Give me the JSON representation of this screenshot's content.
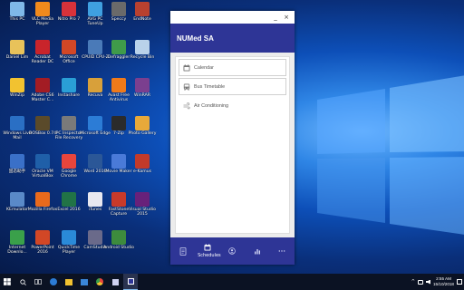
{
  "desktop": {
    "icons": [
      {
        "label": "This PC",
        "color": "#7fb8e8"
      },
      {
        "label": "VLC Media Player",
        "color": "#f08a1c"
      },
      {
        "label": "Nitro Pro 7",
        "color": "#d8323a"
      },
      {
        "label": "AVG PC TuneUp",
        "color": "#3fa0e0"
      },
      {
        "label": "Speccy",
        "color": "#6a6a6a"
      },
      {
        "label": "EndNote",
        "color": "#b8412f"
      },
      {
        "label": "Daniel Lim",
        "color": "#e8c25a"
      },
      {
        "label": "Acrobat Reader DC",
        "color": "#c9242b"
      },
      {
        "label": "Microsoft Office",
        "color": "#d24726"
      },
      {
        "label": "CPUID CPU-Z",
        "color": "#4a7ab8"
      },
      {
        "label": "Defraggler",
        "color": "#3f9b4a"
      },
      {
        "label": "Recycle Bin",
        "color": "#b9d2ea"
      },
      {
        "label": "WinZip",
        "color": "#f2c230"
      },
      {
        "label": "Adobe CS6 Master C...",
        "color": "#a31c24"
      },
      {
        "label": "Instashare",
        "color": "#2a9fd6"
      },
      {
        "label": "Recuva",
        "color": "#d8a03a"
      },
      {
        "label": "Avast Free Antivirus",
        "color": "#f07a1a"
      },
      {
        "label": "WinRAR",
        "color": "#7b3f8f"
      },
      {
        "label": "Windows Live Mail",
        "color": "#2a6fc4"
      },
      {
        "label": "DOSBox 0.74",
        "color": "#5a4a2a"
      },
      {
        "label": "PC Inspector File Recovery",
        "color": "#7a7a7a"
      },
      {
        "label": "Microsoft Edge",
        "color": "#2c7cd6"
      },
      {
        "label": "7-Zip",
        "color": "#2b2b2b"
      },
      {
        "label": "Photo Gallery",
        "color": "#e8a93a"
      },
      {
        "label": "固态助手",
        "color": "#3a70c8"
      },
      {
        "label": "Oracle VM VirtualBox",
        "color": "#1f5fa8"
      },
      {
        "label": "Google Chrome",
        "color": "#e8453c"
      },
      {
        "label": "Word 2016",
        "color": "#2b5797"
      },
      {
        "label": "Movie Maker",
        "color": "#4a7ad8"
      },
      {
        "label": "e-Kamus",
        "color": "#c23a2a"
      },
      {
        "label": "KEmulator",
        "color": "#5a8ac8"
      },
      {
        "label": "Mozilla Firefox",
        "color": "#e86a1c"
      },
      {
        "label": "Excel 2016",
        "color": "#217346"
      },
      {
        "label": "iTunes",
        "color": "#e8e8f0"
      },
      {
        "label": "FastStone Capture",
        "color": "#c83a2a"
      },
      {
        "label": "Visual Studio 2015",
        "color": "#68217a"
      },
      {
        "label": "Internet Downlo...",
        "color": "#3aa04a"
      },
      {
        "label": "PowerPoint 2016",
        "color": "#d24726"
      },
      {
        "label": "QuickTime Player",
        "color": "#2a8ad8"
      },
      {
        "label": "CamStudio",
        "color": "#6a6a8a"
      },
      {
        "label": "Android Studio",
        "color": "#3d8b3d"
      }
    ]
  },
  "app": {
    "title": "NUMed SA",
    "controls": {
      "minimize": "_",
      "close": "×"
    },
    "menu": [
      {
        "label": "Calendar",
        "icon": "calendar-icon"
      },
      {
        "label": "Bus Timetable",
        "icon": "bus-icon"
      },
      {
        "label": "Air Conditioning",
        "icon": "wind-icon"
      }
    ],
    "nav": {
      "items": [
        "document-icon",
        "calendar-icon",
        "person-icon",
        "chart-icon",
        "more-icon"
      ],
      "active_label": "Schedules",
      "active_index": 1
    }
  },
  "taskbar": {
    "time": "2:55 AM",
    "date": "15/10/2018"
  },
  "colors": {
    "app_primary": "#2e3596",
    "taskbar": "#0b1223"
  }
}
